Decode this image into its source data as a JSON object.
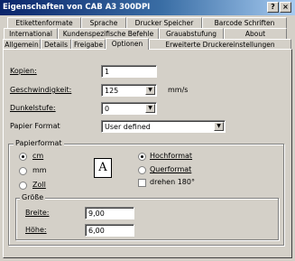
{
  "window": {
    "title": "Eigenschaften von CAB A3 300DPI",
    "help_glyph": "?",
    "close_glyph": "×"
  },
  "tabs": {
    "row1": [
      "Etikettenformate",
      "Sprache",
      "Drucker Speicher",
      "Barcode Schriften"
    ],
    "row2": [
      "International",
      "Kundenspezifische Befehle",
      "Grauabstufung",
      "About"
    ],
    "row3": [
      "Allgemein",
      "Details",
      "Freigabe",
      "Optionen",
      "Erweiterte Druckereinstellungen"
    ],
    "active": "Optionen"
  },
  "form": {
    "kopien_label": "Kopien:",
    "kopien_value": "1",
    "geschwindigkeit_label": "Geschwindigkeit:",
    "geschwindigkeit_value": "125",
    "geschwindigkeit_unit": "mm/s",
    "dunkelstufe_label": "Dunkelstufe:",
    "dunkelstufe_value": "0",
    "papier_format_label": "Papier Format",
    "papier_format_value": "User defined"
  },
  "papierformat": {
    "legend": "Papierformat",
    "unit_cm": "cm",
    "unit_mm": "mm",
    "unit_zoll": "Zoll",
    "selected_unit": "cm",
    "orientation_preview": "A",
    "hochformat": "Hochformat",
    "querformat": "Querformat",
    "selected_orientation": "Hochformat",
    "drehen": "drehen 180°",
    "drehen_checked": false,
    "groesse_legend": "Größe",
    "breite_label": "Breite:",
    "breite_value": "9,00",
    "hoehe_label": "Höhe:",
    "hoehe_value": "6,00"
  }
}
